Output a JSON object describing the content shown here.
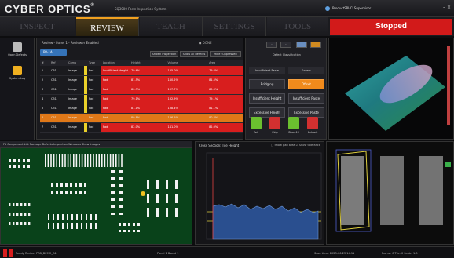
{
  "app": {
    "brand": "CYBER OPTICS",
    "brand_mark": "®",
    "name": "SQ3000 Form Inspection System",
    "user": "ProductSPI-CLSupervisor",
    "colors": {
      "accent": "#f0a020",
      "stop": "#d21a1a",
      "select": "#3573b8",
      "pcb": "#09421a"
    }
  },
  "tabs": [
    {
      "label": "INSPECT",
      "active": false
    },
    {
      "label": "REVIEW",
      "active": true
    },
    {
      "label": "TEACH",
      "active": false
    },
    {
      "label": "SETTINGS",
      "active": false
    },
    {
      "label": "TOOLS",
      "active": false
    }
  ],
  "status": {
    "text": "Stopped"
  },
  "sidebar": {
    "items": [
      {
        "label": "Open Defects",
        "icon": "board-icon"
      },
      {
        "label": "System Log",
        "icon": "log-icon"
      }
    ]
  },
  "review": {
    "breadcrumb": "Review - Panel 1 - Reviewer Enabled",
    "done_label": "DONE",
    "subtab": "PR-1A",
    "filters": [
      "Shown inspection",
      "Show all defects",
      "Hide suppressed"
    ],
    "columns": [
      "#",
      "Ref",
      "Comp",
      "Type",
      "Location",
      "Height",
      "Volume",
      "Area"
    ],
    "rows": [
      {
        "num": "1",
        "ref": "C51",
        "comp": "Image",
        "type": "Pad",
        "loc": "Insufficient Height",
        "height": "79.6%",
        "volume": "135.0%",
        "area": "79.6%",
        "flag": true,
        "sel": false
      },
      {
        "num": "2",
        "ref": "C51",
        "comp": "Image",
        "type": "Pad",
        "loc": "Pad",
        "height": "81.5%",
        "volume": "140.2%",
        "area": "81.5%",
        "flag": true,
        "sel": false
      },
      {
        "num": "3",
        "ref": "C51",
        "comp": "Image",
        "type": "Pad",
        "loc": "Pad",
        "height": "80.3%",
        "volume": "137.7%",
        "area": "80.3%",
        "flag": true,
        "sel": false
      },
      {
        "num": "4",
        "ref": "C51",
        "comp": "Image",
        "type": "Pad",
        "loc": "Pad",
        "height": "79.1%",
        "volume": "132.9%",
        "area": "79.1%",
        "flag": true,
        "sel": false
      },
      {
        "num": "5",
        "ref": "C51",
        "comp": "Image",
        "type": "Pad",
        "loc": "Pad",
        "height": "81.1%",
        "volume": "138.4%",
        "area": "81.1%",
        "flag": true,
        "sel": false
      },
      {
        "num": "6",
        "ref": "C51",
        "comp": "Image",
        "type": "Pad",
        "loc": "Pad",
        "height": "80.8%",
        "volume": "136.5%",
        "area": "80.8%",
        "flag": true,
        "sel": true
      },
      {
        "num": "7",
        "ref": "C51",
        "comp": "Image",
        "type": "Pad",
        "loc": "Pad",
        "height": "82.0%",
        "volume": "141.0%",
        "area": "82.0%",
        "flag": true,
        "sel": false
      }
    ]
  },
  "classification": {
    "title": "Defect Classification",
    "col_headers": [
      "Insufficient Paste",
      "Excess"
    ],
    "buttons": [
      "Bridging",
      "Offset",
      "Insufficient Height",
      "Insufficient Paste",
      "Excessive Height",
      "Excessive Paste"
    ],
    "active": "Offset",
    "actions": [
      "Fail",
      "Skip",
      "Pass All",
      "Submit"
    ],
    "action_colors": [
      "#6bbf2f",
      "#d23030",
      "#6bbf2f",
      "#d23030"
    ]
  },
  "pcb": {
    "toolbar": "Fit  Component List  Package Defects  Inspection Windows  Show Images"
  },
  "xsection": {
    "title": "Cross Section: Tile Height",
    "options": [
      "Show pad area",
      "Show tolerance"
    ]
  },
  "statusbar": {
    "left": "Ready  Recipe: PRB_DEMO_A1",
    "mid": "Panel 1  Board 1",
    "right_a": "Scan time: 2023-06-23 14:11",
    "right_b": "Frame: 0  Tile: 0  Scale: 1.0"
  }
}
